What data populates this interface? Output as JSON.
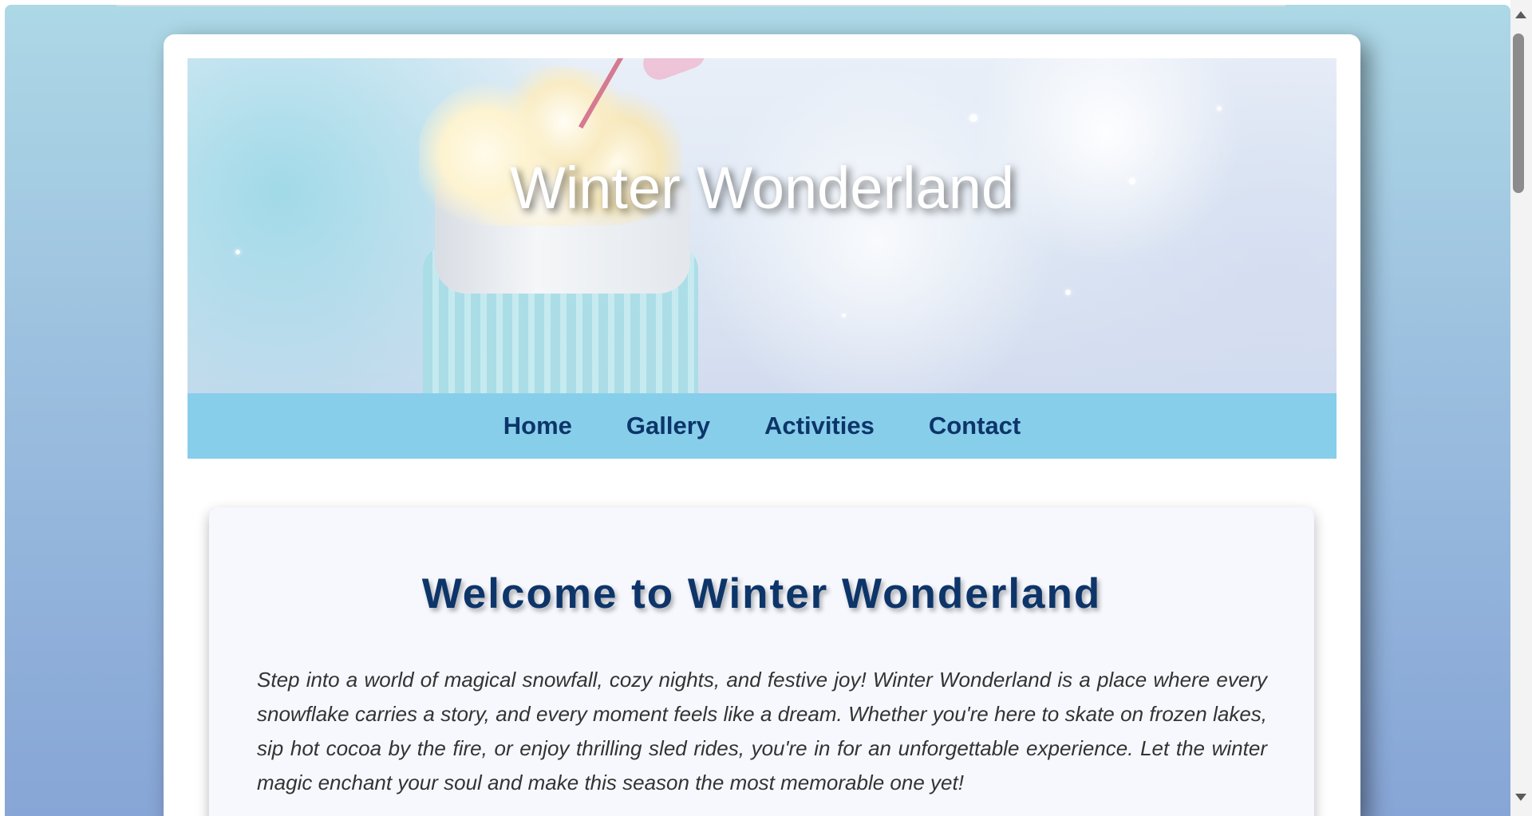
{
  "site": {
    "hero_title": "Winter Wonderland",
    "nav": {
      "items": [
        {
          "label": "Home"
        },
        {
          "label": "Gallery"
        },
        {
          "label": "Activities"
        },
        {
          "label": "Contact"
        }
      ]
    },
    "welcome": {
      "heading": "Welcome to Winter Wonderland",
      "paragraph": "Step into a world of magical snowfall, cozy nights, and festive joy! Winter Wonderland is a place where every snowflake carries a story, and every moment feels like a dream. Whether you're here to skate on frozen lakes, sip hot cocoa by the fire, or enjoy thrilling sled rides, you're in for an unforgettable experience. Let the winter magic enchant your soul and make this season the most memorable one yet!"
    }
  },
  "colors": {
    "nav_background": "#87ceeb",
    "nav_text": "#0d3569",
    "heading_text": "#0d3569",
    "page_background": "#add8e6"
  },
  "icons": {
    "scroll_up": "triangle-up",
    "scroll_down": "triangle-down"
  }
}
